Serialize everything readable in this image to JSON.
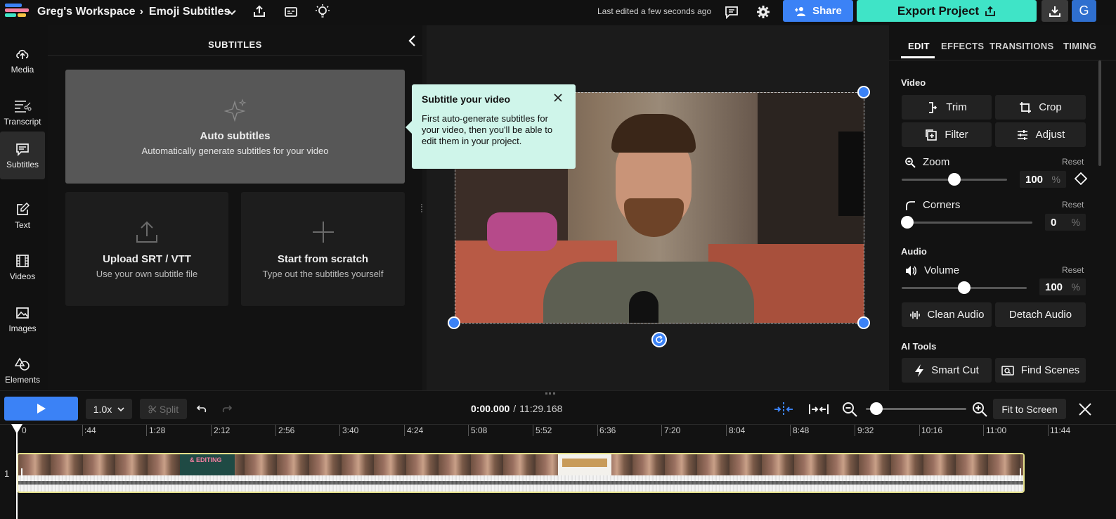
{
  "header": {
    "workspace": "Greg's Workspace",
    "separator": "›",
    "project": "Emoji Subtitles",
    "last_edited": "Last edited a few seconds ago",
    "share_label": "Share",
    "export_label": "Export Project",
    "avatar_initial": "G"
  },
  "nav": {
    "items": [
      {
        "label": "Media",
        "icon": "upload-cloud-icon"
      },
      {
        "label": "Transcript",
        "icon": "transcript-icon"
      },
      {
        "label": "Subtitles",
        "icon": "subtitles-icon"
      },
      {
        "label": "Text",
        "icon": "pencil-icon"
      },
      {
        "label": "Videos",
        "icon": "film-icon"
      },
      {
        "label": "Images",
        "icon": "image-icon"
      },
      {
        "label": "Elements",
        "icon": "shapes-icon"
      }
    ],
    "active": "Subtitles"
  },
  "subtitles_panel": {
    "title": "SUBTITLES",
    "auto": {
      "title": "Auto subtitles",
      "desc": "Automatically generate subtitles for your video"
    },
    "upload": {
      "title": "Upload SRT / VTT",
      "desc": "Use your own subtitle file"
    },
    "scratch": {
      "title": "Start from scratch",
      "desc": "Type out the subtitles yourself"
    }
  },
  "tooltip": {
    "title": "Subtitle your video",
    "body": "First auto-generate subtitles for your video, then you'll be able to edit them in your project."
  },
  "right_panel": {
    "tabs": [
      "EDIT",
      "EFFECTS",
      "TRANSITIONS",
      "TIMING"
    ],
    "active_tab": "EDIT",
    "video_label": "Video",
    "trim": "Trim",
    "crop": "Crop",
    "filter": "Filter",
    "adjust": "Adjust",
    "zoom_label": "Zoom",
    "zoom_value": "100",
    "zoom_level": 0.5,
    "corners_label": "Corners",
    "corners_value": "0",
    "corners_level": 0,
    "reset": "Reset",
    "pct": "%",
    "audio_label": "Audio",
    "volume_label": "Volume",
    "volume_value": "100",
    "volume_level": 0.5,
    "clean_audio": "Clean Audio",
    "detach_audio": "Detach Audio",
    "ai_label": "AI Tools",
    "smart_cut": "Smart Cut",
    "find_scenes": "Find Scenes"
  },
  "timeline": {
    "speed": "1.0x",
    "split": "Split",
    "current_time": "0:00.000",
    "time_separator": "/",
    "total_time": "11:29.168",
    "fit_to_screen": "Fit to Screen",
    "track_number": "1",
    "ruler": [
      "0",
      ":44",
      "1:28",
      "2:12",
      "2:56",
      "3:40",
      "4:24",
      "5:08",
      "5:52",
      "6:36",
      "7:20",
      "8:04",
      "8:48",
      "9:32",
      "10:16",
      "11:00",
      "11:44"
    ],
    "thumbnail_caption": "& EDITING"
  },
  "colors": {
    "accent_blue": "#3b82f6",
    "accent_teal": "#3fe4c7",
    "tooltip_bg": "#cff5ea",
    "clip_border": "#e4e08a"
  }
}
